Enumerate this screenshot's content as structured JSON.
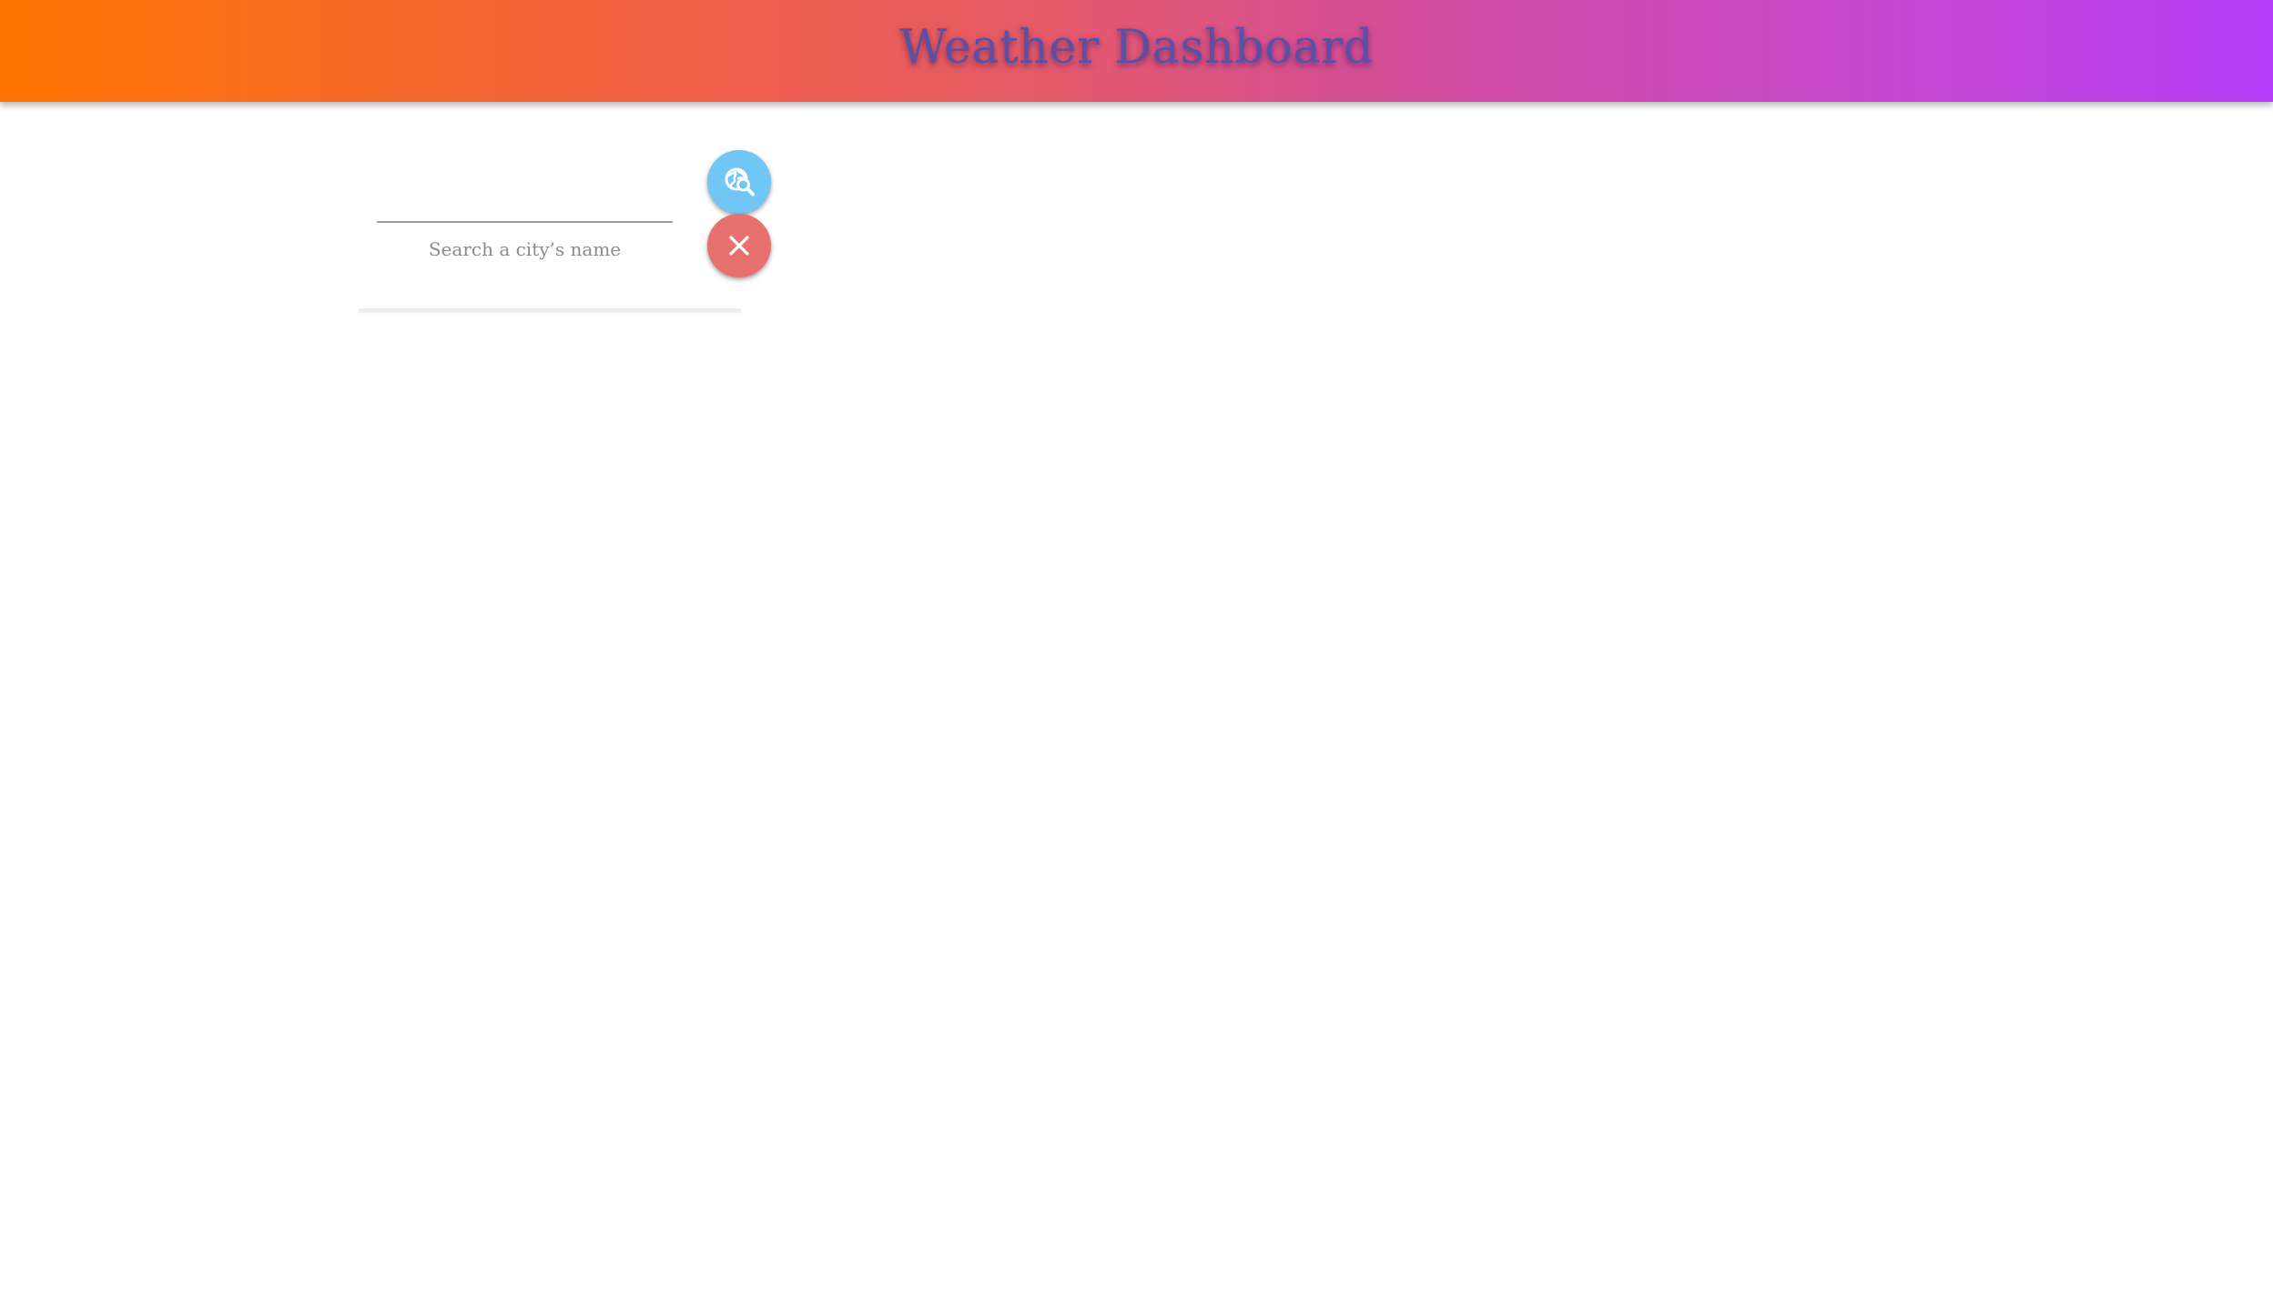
{
  "header": {
    "title": "Weather Dashboard"
  },
  "search": {
    "value": "",
    "helper_text": "Search a city’s name",
    "search_icon": "globe-search-icon",
    "clear_icon": "close-icon"
  },
  "colors": {
    "header_gradient_start": "#ff7400",
    "header_gradient_mid": "#e65b66",
    "header_gradient_end": "#b63ef9",
    "title_text": "#5d4fa4",
    "search_button": "#70c7f6",
    "clear_button": "#e8706f",
    "helper_text": "#8b8b8b"
  }
}
